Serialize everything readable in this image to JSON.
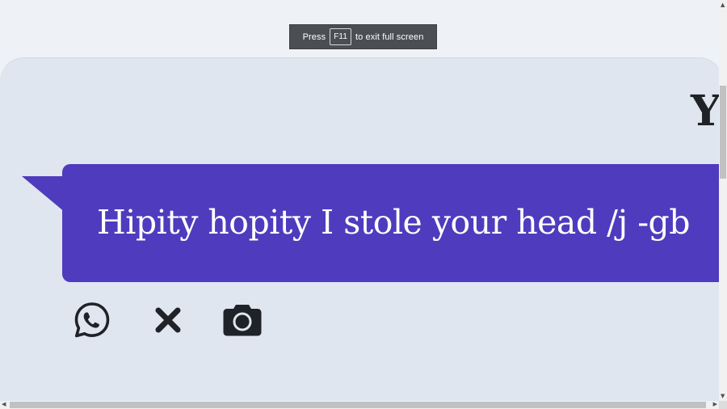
{
  "fullscreen_toast": {
    "prefix": "Press",
    "key": "F11",
    "suffix": "to exit full screen"
  },
  "page": {
    "corner_letter": "Y",
    "bubble_text": "Hipity hopity I stole your head /j -gb",
    "bubble_color": "#4f3bbd",
    "background_color": "#e0e6ef"
  },
  "share_icons": [
    {
      "name": "whatsapp-icon"
    },
    {
      "name": "x-close-icon"
    },
    {
      "name": "camera-icon"
    }
  ],
  "scrollbars": {
    "up_arrow": "▲",
    "down_arrow": "▼",
    "left_arrow": "◀",
    "right_arrow": "▶"
  }
}
